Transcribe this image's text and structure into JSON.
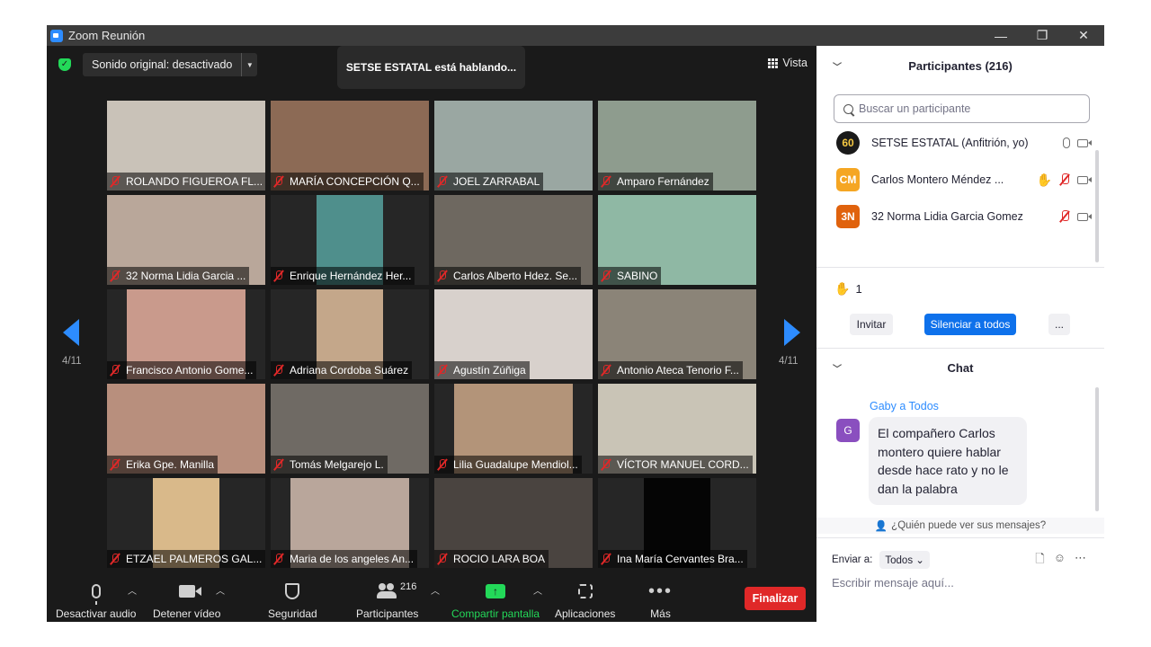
{
  "window": {
    "title": "Zoom Reunión",
    "controls": [
      "—",
      "❐",
      "✕"
    ]
  },
  "meeting": {
    "sound_button": "Sonido original: desactivado",
    "speaking_banner": "SETSE ESTATAL está hablando...",
    "view_label": "Vista",
    "page_indicator_left": "4/11",
    "page_indicator_right": "4/11"
  },
  "tiles": [
    {
      "name": "ROLANDO FIGUEROA FL...",
      "bg": "#c9c2b8",
      "vw": 176,
      "vl": 0
    },
    {
      "name": "MARÍA CONCEPCIÓN Q...",
      "bg": "#8c6a55",
      "vw": 176,
      "vl": 0
    },
    {
      "name": "JOEL ZARRABAL",
      "bg": "#9aa7a2",
      "vw": 176,
      "vl": 0
    },
    {
      "name": "Amparo Fernández",
      "bg": "#8e9c8e",
      "vw": 176,
      "vl": 0
    },
    {
      "name": "32 Norma Lidia Garcia ...",
      "bg": "#b9a79a",
      "vw": 176,
      "vl": 0
    },
    {
      "name": "Enrique Hernández Her...",
      "bg": "#4f8f8c",
      "vw": 74,
      "vl": 51
    },
    {
      "name": "Carlos Alberto Hdez. Se...",
      "bg": "#6e6860",
      "vw": 176,
      "vl": 0
    },
    {
      "name": "SABINO",
      "bg": "#8fb8a4",
      "vw": 176,
      "vl": 0
    },
    {
      "name": "Francisco Antonio Gome...",
      "bg": "#c99a8c",
      "vw": 132,
      "vl": 22
    },
    {
      "name": "Adriana Cordoba Suárez",
      "bg": "#c4a78a",
      "vw": 74,
      "vl": 51
    },
    {
      "name": "Agustín Zúñiga",
      "bg": "#d8d1cc",
      "vw": 176,
      "vl": 0
    },
    {
      "name": "Antonio Ateca Tenorio F...",
      "bg": "#8b8478",
      "vw": 176,
      "vl": 0
    },
    {
      "name": "Erika Gpe. Manilla",
      "bg": "#b88f7d",
      "vw": 176,
      "vl": 0
    },
    {
      "name": "Tomás Melgarejo L.",
      "bg": "#6f6a64",
      "vw": 176,
      "vl": 0
    },
    {
      "name": "Lilia Guadalupe Mendiol...",
      "bg": "#b39479",
      "vw": 132,
      "vl": 22
    },
    {
      "name": "VÍCTOR MANUEL CORD...",
      "bg": "#c9c4b6",
      "vw": 176,
      "vl": 0
    },
    {
      "name": "ETZAEL PALMEROS GAL...",
      "bg": "#d9b98a",
      "vw": 74,
      "vl": 51
    },
    {
      "name": "Maria de los angeles An...",
      "bg": "#b9a69b",
      "vw": 132,
      "vl": 22
    },
    {
      "name": "ROCIO LARA BOA",
      "bg": "#4a4440",
      "vw": 176,
      "vl": 0
    },
    {
      "name": "Ina María Cervantes Bra...",
      "bg": "#050505",
      "vw": 74,
      "vl": 51
    }
  ],
  "toolbar": {
    "mute_audio": "Desactivar audio",
    "stop_video": "Detener vídeo",
    "security": "Seguridad",
    "participants": "Participantes",
    "participants_count": "216",
    "share_screen": "Compartir pantalla",
    "apps": "Aplicaciones",
    "more": "Más",
    "end": "Finalizar"
  },
  "participants_panel": {
    "title": "Participantes (216)",
    "search_placeholder": "Buscar un participante",
    "rows": [
      {
        "avatar": "60",
        "avatar_color": "#1a1a1a",
        "name": "SETSE ESTATAL (Anfitrión, yo)"
      },
      {
        "avatar": "CM",
        "avatar_color": "#f5a623",
        "name": "Carlos Montero  Méndez ..."
      },
      {
        "avatar": "3N",
        "avatar_color": "#e0620d",
        "name": "32 Norma Lidia Garcia Gomez"
      }
    ],
    "raised_hands": "1",
    "invite": "Invitar",
    "mute_all": "Silenciar a todos",
    "more": "..."
  },
  "chat": {
    "title": "Chat",
    "sender": "Gaby a Todos",
    "avatar": "G",
    "message": "El compañero Carlos montero quiere hablar desde hace rato y no le dan la palabra",
    "who_can_see": "¿Quién puede ver sus mensajes?",
    "send_to_label": "Enviar a:",
    "send_to_value": "Todos",
    "input_placeholder": "Escribir mensaje aquí..."
  },
  "colors": {
    "accent_blue": "#2d8cff",
    "share_green": "#23d959",
    "end_red": "#e02828",
    "mute_all_blue": "#0e71eb"
  }
}
